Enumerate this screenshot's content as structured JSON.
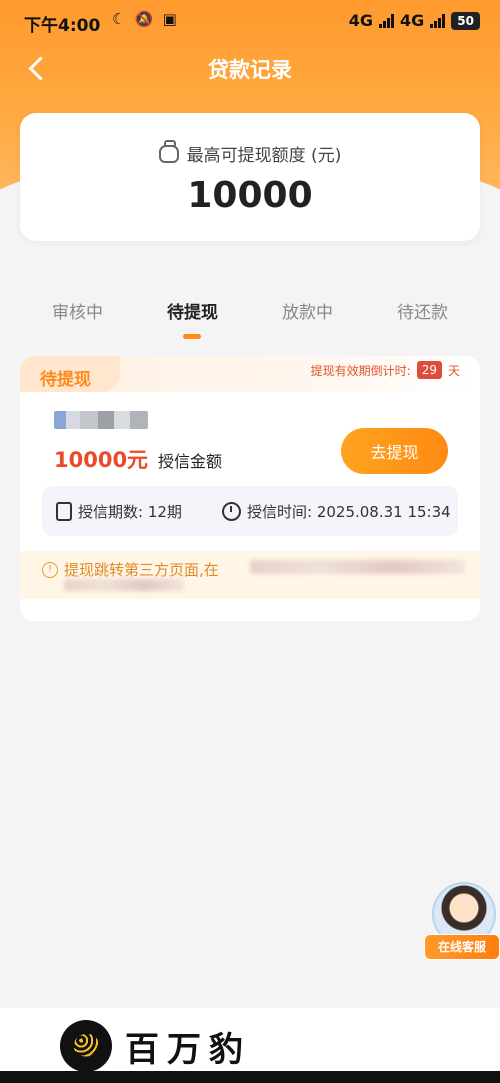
{
  "status_bar": {
    "time": "下午4:00",
    "network_1": "4G",
    "network_2": "4G",
    "battery": "50",
    "icons": [
      "moon-icon",
      "bell-off-icon",
      "app-icon"
    ]
  },
  "header": {
    "title": "贷款记录"
  },
  "quota": {
    "label": "最高可提现额度 (元)",
    "value": "10000"
  },
  "tabs": [
    {
      "label": "审核中",
      "active": false
    },
    {
      "label": "待提现",
      "active": true
    },
    {
      "label": "放款中",
      "active": false
    },
    {
      "label": "待还款",
      "active": false
    }
  ],
  "record": {
    "status": "待提现",
    "countdown_label": "提现有效期倒计时:",
    "countdown_days": "29",
    "countdown_unit": "天",
    "amount": "10000元",
    "amount_label": "授信金额",
    "withdraw_button": "去提现",
    "term": "授信期数: 12期",
    "credit_time": "授信时间: 2025.08.31 15:34",
    "notice": "提现跳转第三方页面,在"
  },
  "support": {
    "label": "在线客服"
  },
  "brand": {
    "name": "百万豹"
  },
  "colors": {
    "accent": "#ff8a1a",
    "amount": "#e84a2a",
    "countdown_badge": "#e04c3a"
  }
}
